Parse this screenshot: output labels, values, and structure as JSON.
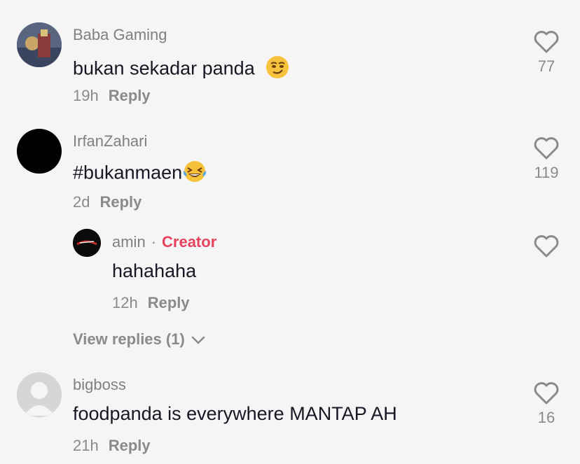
{
  "comments": [
    {
      "username": "Baba Gaming",
      "text": "bukan sekadar panda",
      "emoji": "smirk-emoji",
      "time": "19h",
      "reply_label": "Reply",
      "likes": "77"
    },
    {
      "username": "IrfanZahari",
      "text": "#bukanmaen",
      "emoji": "laughing-tears-emoji",
      "time": "2d",
      "reply_label": "Reply",
      "likes": "119",
      "replies": [
        {
          "username": "amin",
          "separator": "·",
          "badge": "Creator",
          "text": "hahahaha",
          "time": "12h",
          "reply_label": "Reply"
        }
      ],
      "view_replies_label": "View replies (1)"
    },
    {
      "username": "bigboss",
      "text": "foodpanda is everywhere MANTAP AH",
      "time": "21h",
      "reply_label": "Reply",
      "likes": "16"
    }
  ],
  "colors": {
    "background": "#f5f5f5",
    "creator_badge": "#e5425c",
    "muted_text": "#8a8a8a",
    "main_text": "#161823"
  }
}
